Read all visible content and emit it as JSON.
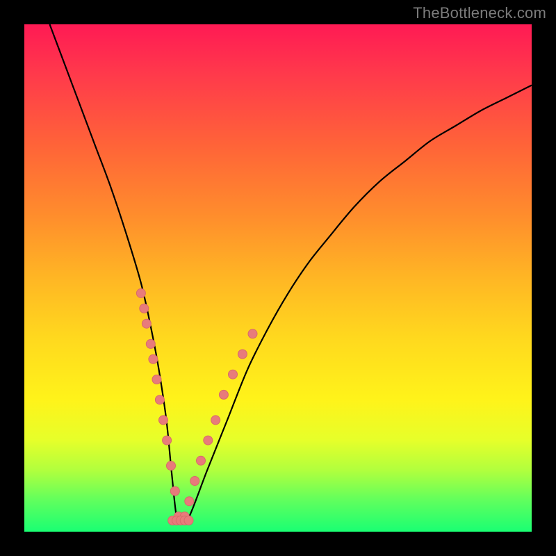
{
  "watermark": "TheBottleneck.com",
  "chart_data": {
    "type": "line",
    "title": "",
    "xlabel": "",
    "ylabel": "",
    "xlim": [
      0,
      100
    ],
    "ylim": [
      0,
      100
    ],
    "grid": false,
    "legend": false,
    "annotations": [],
    "series": [
      {
        "name": "v-curve",
        "stroke": "#000000",
        "x": [
          5,
          8,
          11,
          14,
          17,
          20,
          23,
          25,
          26.5,
          28,
          29,
          30,
          31,
          32.5,
          36,
          40,
          44,
          48,
          52,
          56,
          60,
          65,
          70,
          75,
          80,
          85,
          90,
          95,
          100
        ],
        "y": [
          100,
          92,
          84,
          76,
          68,
          59,
          49,
          40,
          32,
          22,
          12,
          3,
          2,
          3,
          12,
          22,
          32,
          40,
          47,
          53,
          58,
          64,
          69,
          73,
          77,
          80,
          83,
          85.5,
          88
        ]
      }
    ],
    "points_left": {
      "name": "dots-left-branch",
      "fill": "#e87b7b",
      "x": [
        23.0,
        23.6,
        24.1,
        24.9,
        25.4,
        26.1,
        26.7,
        27.4,
        28.1,
        28.9,
        29.7,
        30.4
      ],
      "y": [
        47,
        44,
        41,
        37,
        34,
        30,
        26,
        22,
        18,
        13,
        8,
        3
      ]
    },
    "points_right": {
      "name": "dots-right-branch",
      "fill": "#e87b7b",
      "x": [
        31.6,
        32.5,
        33.6,
        34.8,
        36.2,
        37.7,
        39.3,
        41.1,
        43.0,
        45.0
      ],
      "y": [
        3,
        6,
        10,
        14,
        18,
        22,
        27,
        31,
        35,
        39
      ]
    },
    "plateau": {
      "name": "dots-valley",
      "fill": "#e87b7b",
      "x": [
        29.2,
        30.0,
        30.8,
        31.6,
        32.4
      ],
      "y": [
        2.2,
        2.2,
        2.2,
        2.2,
        2.2
      ]
    }
  }
}
